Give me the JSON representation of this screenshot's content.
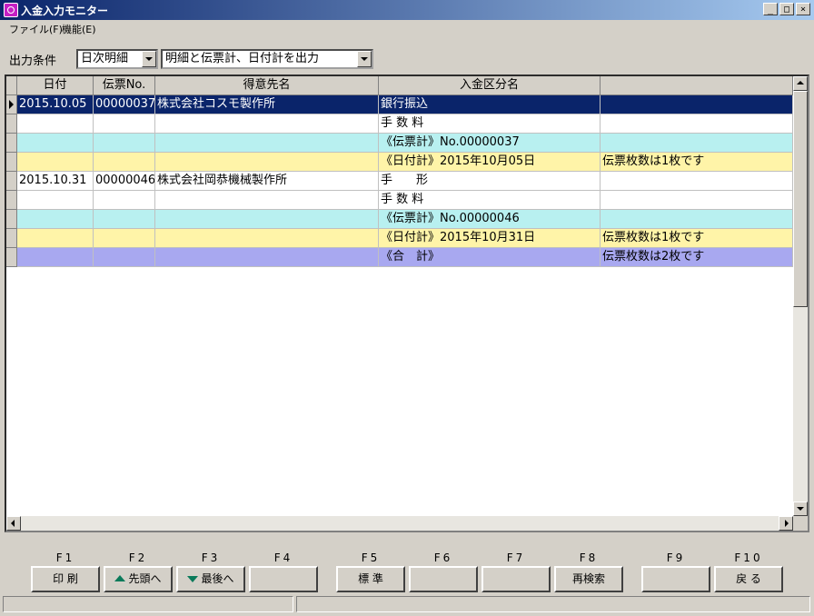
{
  "window": {
    "title": "入金入力モニター",
    "min": "_",
    "max": "□",
    "close": "×"
  },
  "menu": [
    "ファイル(F)",
    "機能(E)"
  ],
  "filter": {
    "label": "出力条件",
    "mode": "日次明細",
    "output": "明細と伝票計、日付計を出力"
  },
  "table": {
    "columns": [
      "日付",
      "伝票No.",
      "得意先名",
      "入金区分名",
      ""
    ],
    "rows": [
      {
        "date": "2015.10.05",
        "no": "00000037",
        "customer": "株式会社コスモ製作所",
        "kind": "銀行振込",
        "note": "",
        "bg": "#0a246a",
        "fg": "#ffffff",
        "current": true
      },
      {
        "date": "",
        "no": "",
        "customer": "",
        "kind": "手 数 料",
        "note": "",
        "bg": "#ffffff",
        "fg": "#000000"
      },
      {
        "date": "",
        "no": "",
        "customer": "",
        "kind": "《伝票計》No.00000037",
        "note": "",
        "bg": "#b8f0f0",
        "fg": "#000000"
      },
      {
        "date": "",
        "no": "",
        "customer": "",
        "kind": "《日付計》2015年10月05日",
        "note": "伝票枚数は1枚です",
        "bg": "#fff4a8",
        "fg": "#000000"
      },
      {
        "date": "2015.10.31",
        "no": "00000046",
        "customer": "株式会社岡恭機械製作所",
        "kind": "手　　形",
        "note": "",
        "bg": "#ffffff",
        "fg": "#000000"
      },
      {
        "date": "",
        "no": "",
        "customer": "",
        "kind": "手 数 料",
        "note": "",
        "bg": "#ffffff",
        "fg": "#000000"
      },
      {
        "date": "",
        "no": "",
        "customer": "",
        "kind": "《伝票計》No.00000046",
        "note": "",
        "bg": "#b8f0f0",
        "fg": "#000000"
      },
      {
        "date": "",
        "no": "",
        "customer": "",
        "kind": "《日付計》2015年10月31日",
        "note": "伝票枚数は1枚です",
        "bg": "#fff4a8",
        "fg": "#000000"
      },
      {
        "date": "",
        "no": "",
        "customer": "",
        "kind": "《合　計》",
        "note": "伝票枚数は2枚です",
        "bg": "#a8a8f0",
        "fg": "#000000"
      }
    ]
  },
  "fkeys": [
    {
      "key": "F1",
      "label": "印 刷",
      "icon": ""
    },
    {
      "key": "F2",
      "label": "先頭へ",
      "icon": "up-arrow-icon"
    },
    {
      "key": "F3",
      "label": "最後へ",
      "icon": "down-arrow-icon"
    },
    {
      "key": "F4",
      "label": "",
      "icon": ""
    },
    {
      "key": "F5",
      "label": "標 準",
      "icon": ""
    },
    {
      "key": "F6",
      "label": "",
      "icon": ""
    },
    {
      "key": "F7",
      "label": "",
      "icon": ""
    },
    {
      "key": "F8",
      "label": "再検索",
      "icon": ""
    },
    {
      "key": "F9",
      "label": "",
      "icon": ""
    },
    {
      "key": "F10",
      "label": "戻 る",
      "icon": ""
    }
  ]
}
